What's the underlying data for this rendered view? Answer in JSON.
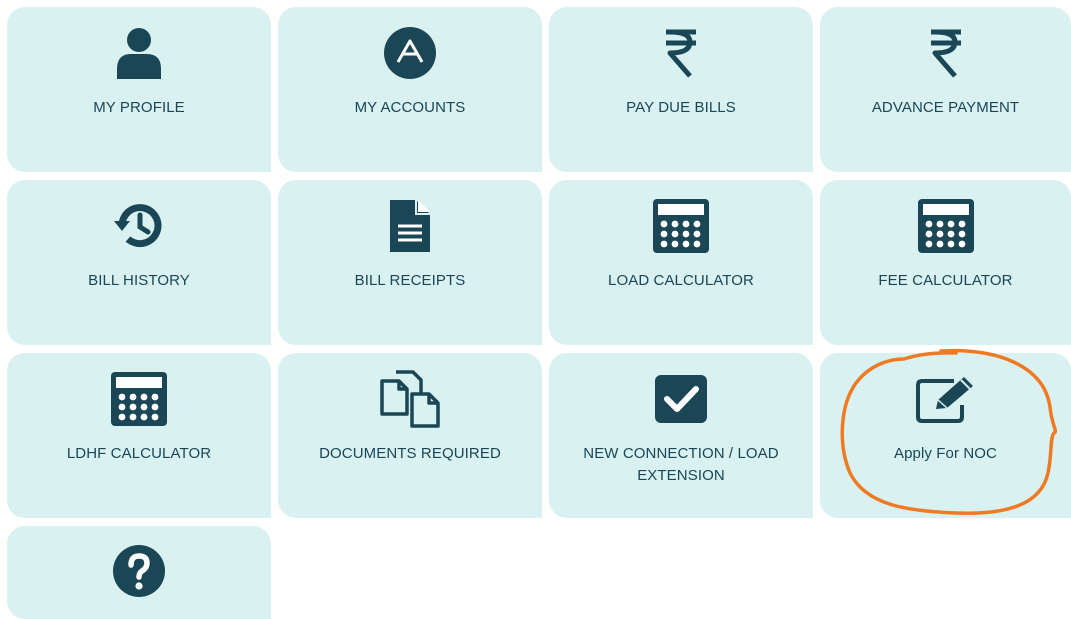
{
  "tiles": [
    {
      "label": "MY PROFILE",
      "icon": "user-icon"
    },
    {
      "label": "MY ACCOUNTS",
      "icon": "accounts-icon"
    },
    {
      "label": "PAY DUE BILLS",
      "icon": "rupee-icon"
    },
    {
      "label": "ADVANCE PAYMENT",
      "icon": "rupee-icon"
    },
    {
      "label": "BILL HISTORY",
      "icon": "history-icon"
    },
    {
      "label": "BILL RECEIPTS",
      "icon": "document-icon"
    },
    {
      "label": "LOAD CALCULATOR",
      "icon": "calculator-icon"
    },
    {
      "label": "FEE CALCULATOR",
      "icon": "calculator-icon"
    },
    {
      "label": "LDHF CALCULATOR",
      "icon": "calculator-icon"
    },
    {
      "label": "DOCUMENTS REQUIRED",
      "icon": "copy-documents-icon"
    },
    {
      "label": "NEW CONNECTION / LOAD EXTENSION",
      "icon": "checkbox-icon"
    },
    {
      "label": "Apply For NOC",
      "icon": "edit-icon"
    },
    {
      "label": "",
      "icon": "help-icon"
    }
  ],
  "colors": {
    "tile_bg": "#d9f1f1",
    "icon": "#1b4655",
    "text": "#1b4655",
    "annotation": "#f07a23"
  }
}
